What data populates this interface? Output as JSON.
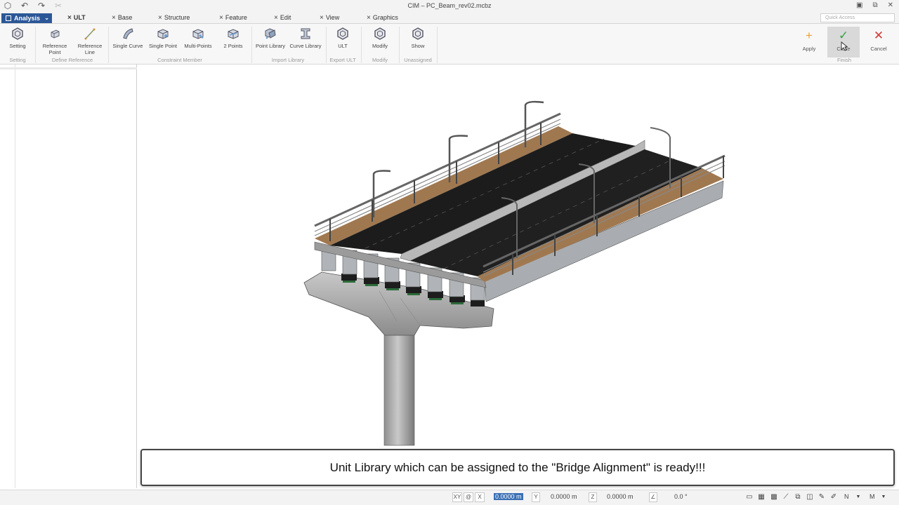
{
  "window": {
    "title": "CIM – PC_Beam_rev02.mcbz",
    "controls": [
      "▣",
      "⧉",
      "✕"
    ]
  },
  "menubar": {
    "workspace": "Analysis",
    "tabs": [
      "ULT",
      "Base",
      "Structure",
      "Feature",
      "Edit",
      "View",
      "Graphics"
    ],
    "active_tab": "ULT",
    "quick_access_placeholder": "Quick Access"
  },
  "ribbon": {
    "buttons": {
      "setting": "Setting",
      "reference_point_1": "Reference",
      "reference_point_2": "Point",
      "reference_line_1": "Reference",
      "reference_line_2": "Line",
      "single_curve": "Single Curve",
      "single_point": "Single Point",
      "multi_points": "Multi-Points",
      "two_points": "2 Points",
      "point_library": "Point Library",
      "curve_library": "Curve Library",
      "ult": "ULT",
      "modify": "Modify",
      "show": "Show"
    },
    "groups": {
      "setting": "Setting",
      "define_reference": "Define Reference",
      "constraint_member": "Constraint Member",
      "import_library": "Import Library",
      "export_ult": "Export ULT",
      "modify": "Modify",
      "unassigned": "Unassigned",
      "finish": "Finish"
    },
    "finish": {
      "apply": "Apply",
      "close": "Close",
      "cancel": "Cancel"
    }
  },
  "caption": "Unit Library which can be assigned to the \"Bridge Alignment\" is ready!!!",
  "statusbar": {
    "mode_xy": "XY",
    "mode_at": "@",
    "x_label": "X",
    "x_value": "0.0000 m",
    "y_label": "Y",
    "y_value": "0.0000 m",
    "z_label": "Z",
    "z_value": "0.0000 m",
    "angle_label": "∠",
    "angle_value": "0.0 °",
    "snap_n": "N",
    "snap_m": "M"
  },
  "colors": {
    "workspace_bg": "#2b5797",
    "apply_icon": "#f0a030",
    "close_icon": "#3aa04a",
    "cancel_icon": "#d33a3a"
  }
}
